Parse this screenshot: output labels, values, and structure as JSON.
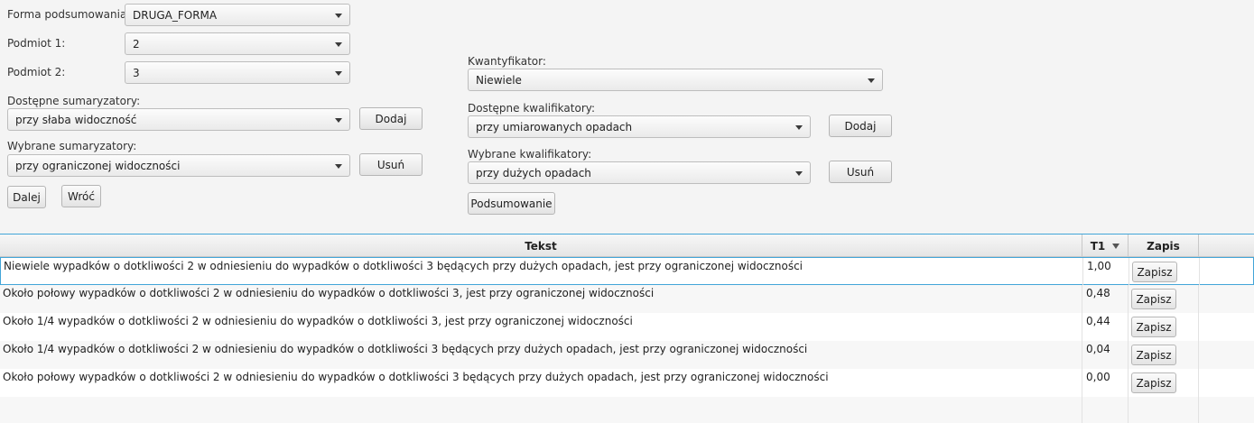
{
  "form": {
    "summary_form_label": "Forma podsumowania:",
    "summary_form_value": "DRUGA_FORMA",
    "subject1_label": "Podmiot 1:",
    "subject1_value": "2",
    "subject2_label": "Podmiot 2:",
    "subject2_value": "3",
    "available_summarizers_label": "Dostępne sumaryzatory:",
    "available_summarizers_value": "przy słaba widoczność",
    "add_label": "Dodaj",
    "selected_summarizers_label": "Wybrane sumaryzatory:",
    "selected_summarizers_value": "przy ograniczonej widoczności",
    "remove_label": "Usuń",
    "next_label": "Dalej",
    "back_label": "Wróć",
    "quantifier_label": "Kwantyfikator:",
    "quantifier_value": "Niewiele",
    "available_qualifiers_label": "Dostępne kwalifikatory:",
    "available_qualifiers_value": "przy umiarowanych opadach",
    "qualifier_add_label": "Dodaj",
    "selected_qualifiers_label": "Wybrane kwalifikatory:",
    "selected_qualifiers_value": "przy dużych opadach",
    "qualifier_remove_label": "Usuń",
    "summary_button_label": "Podsumowanie"
  },
  "table": {
    "columns": [
      "Tekst",
      "T1",
      "Zapis"
    ],
    "rows": [
      {
        "text": "Niewiele wypadków o dotkliwości 2 w odniesieniu do wypadków o dotkliwości 3 będących przy dużych opadach, jest przy ograniczonej widoczności",
        "t1": "1,00",
        "action": "Zapisz"
      },
      {
        "text": "Około połowy wypadków o dotkliwości 2 w odniesieniu do wypadków o dotkliwości 3, jest przy ograniczonej widoczności",
        "t1": "0,48",
        "action": "Zapisz"
      },
      {
        "text": "Około 1/4 wypadków o dotkliwości 2 w odniesieniu do wypadków o dotkliwości 3, jest przy ograniczonej widoczności",
        "t1": "0,44",
        "action": "Zapisz"
      },
      {
        "text": "Około 1/4 wypadków o dotkliwości 2 w odniesieniu do wypadków o dotkliwości 3 będących przy dużych opadach, jest przy ograniczonej widoczności",
        "t1": "0,04",
        "action": "Zapisz"
      },
      {
        "text": "Około połowy wypadków o dotkliwości 2 w odniesieniu do wypadków o dotkliwości 3 będących przy dużych opadach, jest przy ograniczonej widoczności",
        "t1": "0,00",
        "action": "Zapisz"
      }
    ]
  },
  "colors": {
    "accent": "#42a5d8",
    "background": "#f4f4f4"
  }
}
